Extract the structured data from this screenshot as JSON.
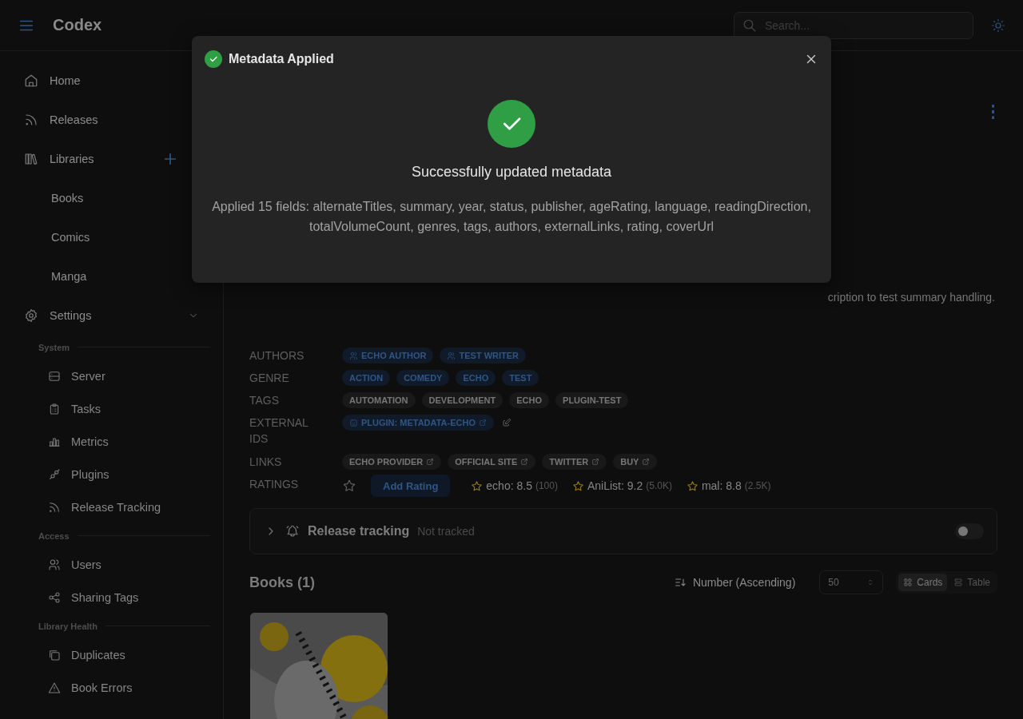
{
  "header": {
    "title": "Codex",
    "search": {
      "placeholder": "Search..."
    }
  },
  "sidebar": {
    "items": [
      {
        "label": "Home"
      },
      {
        "label": "Releases"
      },
      {
        "label": "Libraries",
        "children": [
          {
            "label": "Books"
          },
          {
            "label": "Comics"
          },
          {
            "label": "Manga"
          }
        ]
      },
      {
        "label": "Settings",
        "expanded": true
      }
    ],
    "sections": [
      {
        "title": "System",
        "items": [
          {
            "label": "Server"
          },
          {
            "label": "Tasks"
          },
          {
            "label": "Metrics"
          },
          {
            "label": "Plugins"
          },
          {
            "label": "Release Tracking"
          }
        ]
      },
      {
        "title": "Access",
        "items": [
          {
            "label": "Users"
          },
          {
            "label": "Sharing Tags"
          }
        ]
      },
      {
        "title": "Library Health",
        "items": [
          {
            "label": "Duplicates"
          },
          {
            "label": "Book Errors"
          }
        ]
      }
    ]
  },
  "series": {
    "description_tail": "cription to test summary handling.",
    "metadata": [
      {
        "label": "AUTHORS",
        "kind": "author",
        "chips": [
          "ECHO AUTHOR",
          "TEST WRITER"
        ]
      },
      {
        "label": "GENRE",
        "kind": "genre",
        "chips": [
          "ACTION",
          "COMEDY",
          "ECHO",
          "TEST"
        ]
      },
      {
        "label": "TAGS",
        "kind": "tag",
        "chips": [
          "AUTOMATION",
          "DEVELOPMENT",
          "ECHO",
          "PLUGIN-TEST"
        ]
      },
      {
        "label": "EXTERNAL IDS",
        "kind": "external_id",
        "chips": [
          "PLUGIN: METADATA-ECHO"
        ],
        "editable": true
      },
      {
        "label": "LINKS",
        "kind": "link",
        "chips": [
          "ECHO PROVIDER",
          "OFFICIAL SITE",
          "TWITTER",
          "BUY"
        ]
      }
    ],
    "ratings": {
      "label": "RATINGS",
      "add_button": "Add Rating",
      "items": [
        {
          "source": "echo: 8.5",
          "count": "(100)"
        },
        {
          "source": "AniList: 9.2",
          "count": "(5.0K)"
        },
        {
          "source": "mal: 8.8",
          "count": "(2.5K)"
        }
      ]
    }
  },
  "release_tracking": {
    "title": "Release tracking",
    "status": "Not tracked",
    "on": false
  },
  "books": {
    "title": "Books (1)",
    "sort": "Number (Ascending)",
    "page_size": "50",
    "views": [
      {
        "label": "Cards",
        "selected": true
      },
      {
        "label": "Table",
        "selected": false
      }
    ]
  },
  "modal": {
    "title": "Metadata Applied",
    "heading": "Successfully updated metadata",
    "message": "Applied 15 fields: alternateTitles, summary, year, status, publisher, ageRating, language, readingDirection, totalVolumeCount, genres, tags, authors, externalLinks, rating, coverUrl"
  }
}
